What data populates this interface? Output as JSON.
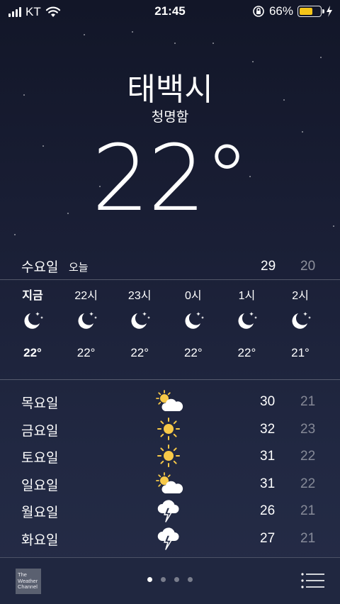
{
  "status_bar": {
    "carrier": "KT",
    "time": "21:45",
    "battery_percent": "66%",
    "battery_level": 0.66,
    "battery_color": "#f5c518"
  },
  "location": {
    "city": "태백시",
    "condition": "청명함",
    "temperature": "22°"
  },
  "today": {
    "day": "수요일",
    "label": "오늘",
    "high": "29",
    "low": "20"
  },
  "hourly": [
    {
      "time": "지금",
      "icon": "moon-stars-icon",
      "temp": "22°",
      "bold": true
    },
    {
      "time": "22시",
      "icon": "moon-stars-icon",
      "temp": "22°"
    },
    {
      "time": "23시",
      "icon": "moon-stars-icon",
      "temp": "22°"
    },
    {
      "time": "0시",
      "icon": "moon-stars-icon",
      "temp": "22°"
    },
    {
      "time": "1시",
      "icon": "moon-stars-icon",
      "temp": "22°"
    },
    {
      "time": "2시",
      "icon": "moon-stars-icon",
      "temp": "21°"
    }
  ],
  "daily": [
    {
      "day": "목요일",
      "icon": "partly-sunny-icon",
      "high": "30",
      "low": "21"
    },
    {
      "day": "금요일",
      "icon": "sunny-icon",
      "high": "32",
      "low": "23"
    },
    {
      "day": "토요일",
      "icon": "sunny-icon",
      "high": "31",
      "low": "22"
    },
    {
      "day": "일요일",
      "icon": "partly-sunny-icon",
      "high": "31",
      "low": "22"
    },
    {
      "day": "월요일",
      "icon": "thunderstorm-icon",
      "high": "26",
      "low": "21"
    },
    {
      "day": "화요일",
      "icon": "thunderstorm-icon",
      "high": "27",
      "low": "21"
    }
  ],
  "bottom_bar": {
    "logo_lines": [
      "The",
      "Weather",
      "Channel"
    ],
    "page_count": 4,
    "active_page": 0
  }
}
